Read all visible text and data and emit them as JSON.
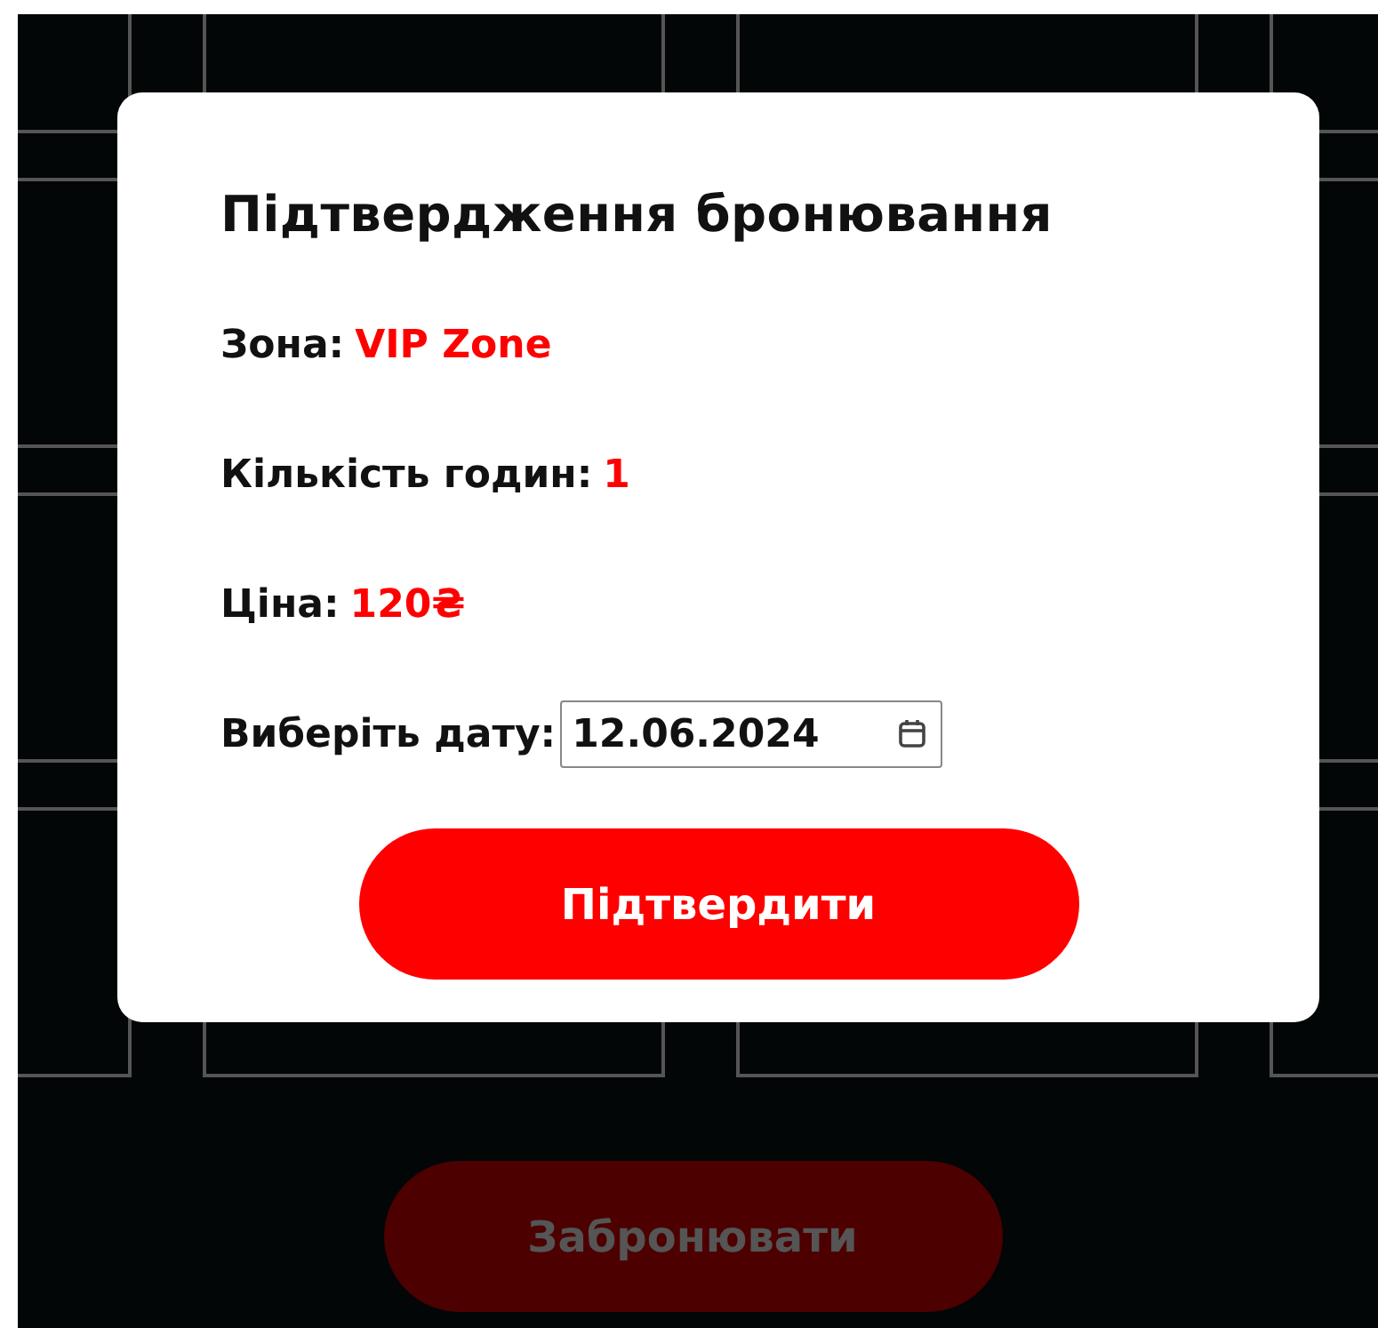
{
  "dialog": {
    "title": "Підтвердження бронювання",
    "fields": [
      {
        "label": "Зона:",
        "value": "VIP Zone"
      },
      {
        "label": "Кількість годин:",
        "value": "1"
      },
      {
        "label": "Ціна:",
        "value": "120₴"
      }
    ],
    "date": {
      "label": "Виберіть дату:",
      "value": "12.06.2024"
    },
    "confirm_button": "Підтвердити"
  },
  "book_button": "Забронювати"
}
